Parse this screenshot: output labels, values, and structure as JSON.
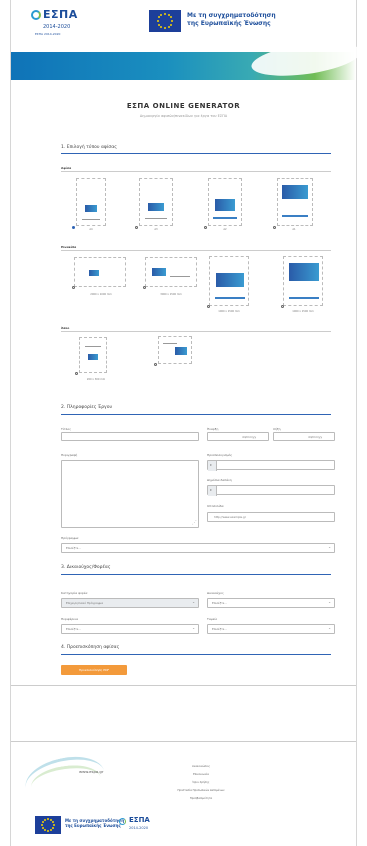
{
  "header": {
    "logo_text": "ΕΣΠΑ",
    "logo_years": "2014-2020",
    "logo_sub": "ΕΣΠΑ 2014-2020",
    "eu_text_line1": "Με τη συγχρηματοδότηση",
    "eu_text_line2": "της Ευρωπαϊκής Ένωσης"
  },
  "colors": {
    "accent": "#2f64b5",
    "button": "#f39a3b",
    "brand": "#1d4e9b"
  },
  "title": "ΕΣΠΑ ONLINE GENERATOR",
  "subtitle": "Δημιουργία αφισών/πινακίδων για έργα του ΕΣΠΑ",
  "section1": {
    "title": "1. Επιλογή τύπου αφίσας",
    "group_posters": {
      "label": "Αφίσα",
      "captions": [
        "A4",
        "A3",
        "A2",
        "A1"
      ]
    },
    "group_signs": {
      "label": "Πινακίδα",
      "captions": [
        "2000 x 1000 mm",
        "3000 x 1500 mm",
        "1000 x 1500 mm",
        "1000 x 1500 mm"
      ]
    },
    "group_other": {
      "label": "Άλλο",
      "captions": [
        "200 x 300 mm",
        ""
      ]
    }
  },
  "section2": {
    "title": "2. Πληροφορίες Έργου",
    "fields": {
      "name_label": "Τίτλος",
      "start_label": "Έναρξη",
      "start_value": "dd/mm/yy",
      "end_label": "Λήξη",
      "end_value": "dd/mm/yy",
      "desc_label": "Περιγραφή",
      "budget_label": "Προϋπολογισμός",
      "budget_value": "€",
      "public_label": "Δημόσια δαπάνη",
      "public_value": "€",
      "web_label": "Ιστοσελίδα",
      "web_placeholder": "http://www.example.gr",
      "program_label": "Πρόγραμμα",
      "program_value": "Επιλέξτε..."
    }
  },
  "section3": {
    "title": "3. Δικαιούχος/Φορέας",
    "fields": {
      "a_label": "Κατηγορία φορέα",
      "a_value": "Επιχειρησιακό Πρόγραμμα",
      "b_label": "Δικαιούχος",
      "b_value": "Επιλέξτε...",
      "c_label": "Περιφέρεια",
      "c_value": "Επιλέξτε...",
      "d_label": "Ταμείο",
      "d_value": "Επιλέξτε..."
    }
  },
  "section4": {
    "title": "4. Προεπισκόπηση αφίσας",
    "button": "Προεπισκόπηση PDF"
  },
  "footer": {
    "site": "www.espa.gr",
    "links": [
      "Ανακοινώσεις",
      "Επικοινωνία",
      "Όροι Χρήσης",
      "Προστασία Προσωπικών Δεδομένων",
      "Προσβασιμότητα"
    ],
    "eu_text_line1": "Με τη συγχρηματοδότηση",
    "eu_text_line2": "της Ευρωπαϊκής Ένωσης",
    "logo_text": "ΕΣΠΑ",
    "logo_years": "2014-2020"
  }
}
